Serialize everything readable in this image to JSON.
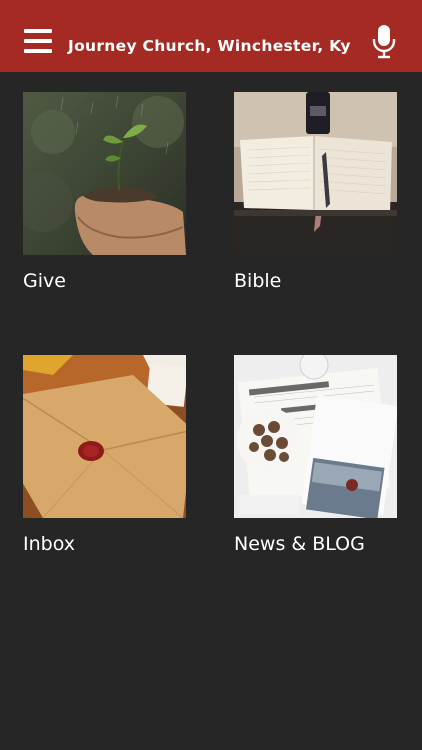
{
  "header": {
    "title": "Journey Church, Winchester, Ky",
    "menu_icon": "hamburger-menu-icon",
    "mic_icon": "microphone-icon",
    "background_color": "#a52a24"
  },
  "tiles": [
    {
      "label": "Give",
      "image": "hands-holding-seedling-photo"
    },
    {
      "label": "Bible",
      "image": "open-notebook-with-pen-photo"
    },
    {
      "label": "Inbox",
      "image": "sealed-envelope-with-wax-seal-photo"
    },
    {
      "label": "News & BLOG",
      "image": "newspapers-and-magazine-photo"
    }
  ],
  "colors": {
    "page_background": "#262626",
    "text": "#ffffff"
  }
}
